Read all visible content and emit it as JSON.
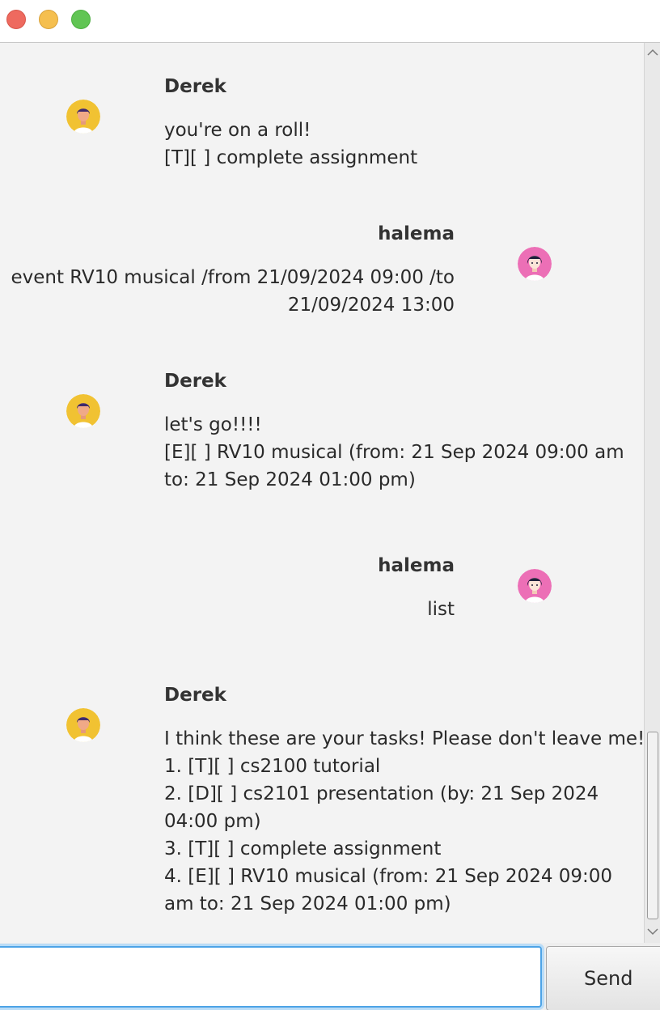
{
  "window": {
    "controls": [
      "close",
      "minimize",
      "maximize"
    ]
  },
  "messages": [
    {
      "sender": "Derek",
      "role": "bot",
      "lines": [
        "you're on a roll!",
        "[T][ ]  complete assignment"
      ]
    },
    {
      "sender": "halema",
      "role": "user",
      "lines": [
        "event RV10 musical /from 21/09/2024 09:00 /to",
        "21/09/2024 13:00"
      ]
    },
    {
      "sender": "Derek",
      "role": "bot",
      "lines": [
        "let's go!!!!",
        "[E][ ] RV10 musical  (from: 21 Sep 2024 09:00 am",
        "to: 21 Sep 2024 01:00 pm)"
      ]
    },
    {
      "sender": "halema",
      "role": "user",
      "lines": [
        "list"
      ]
    },
    {
      "sender": "Derek",
      "role": "bot",
      "lines": [
        "I think these are your tasks! Please don't leave me!!",
        "1. [T][ ] cs2100 tutorial",
        "2. [D][ ]  cs2101 presentation  (by: 21 Sep 2024",
        "04:00 pm)",
        "3. [T][ ]  complete assignment",
        "4. [E][ ] RV10 musical  (from: 21 Sep 2024 09:00",
        "am to: 21 Sep 2024 01:00 pm)"
      ]
    }
  ],
  "avatars": {
    "bot": {
      "icon": "bot-avatar-icon",
      "bg": "#f1c232"
    },
    "user": {
      "icon": "user-avatar-icon",
      "bg": "#ec6fb6"
    }
  },
  "input": {
    "value": "",
    "placeholder": ""
  },
  "send_label": "Send",
  "scroll_position": 0.9
}
